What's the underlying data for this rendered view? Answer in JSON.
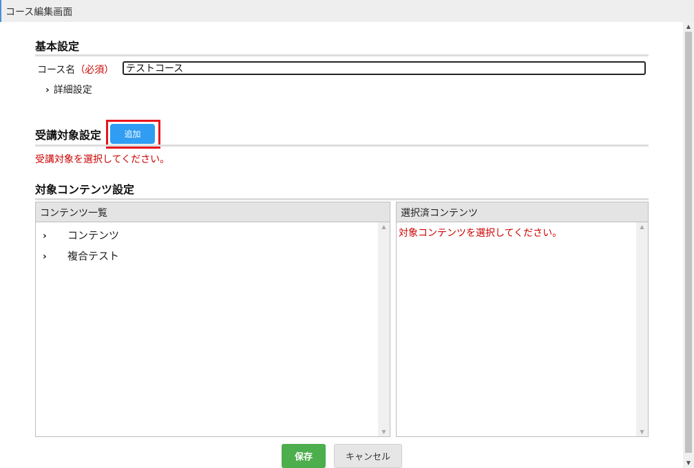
{
  "window": {
    "title": "コース編集画面"
  },
  "basic": {
    "heading": "基本設定",
    "course_name_label": "コース名",
    "required_label": "（必須）",
    "course_name_value": "テストコース",
    "detail_label": "詳細設定"
  },
  "target": {
    "heading": "受講対象設定",
    "add_label": "追加",
    "error": "受講対象を選択してください。"
  },
  "content": {
    "heading": "対象コンテンツ設定",
    "list_header": "コンテンツ一覧",
    "items": [
      {
        "label": "コンテンツ"
      },
      {
        "label": "複合テスト"
      }
    ],
    "selected_header": "選択済コンテンツ",
    "selected_error": "対象コンテンツを選択してください。"
  },
  "footer": {
    "save_label": "保存",
    "cancel_label": "キャンセル"
  },
  "colors": {
    "accent": "#2f9df3",
    "save": "#4cae4c",
    "error": "#cc0000",
    "highlight": "#e8141c"
  }
}
